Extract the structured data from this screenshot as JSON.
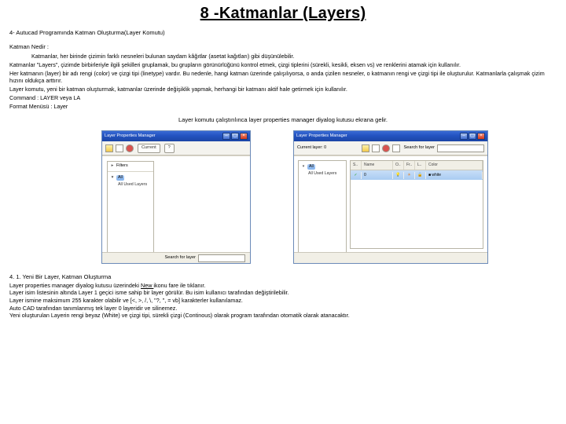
{
  "page": {
    "title": "8 -Katmanlar (Layers)",
    "subheader": "4- Autucad Programında Katman Oluşturma(Layer Komutu)",
    "section_katman_nedir": "Katman Nedir :",
    "p1": "Katmanlar, her birinde çizimin farklı nesneleri bulunan saydam kâğıtlar (asetat kağıtları) gibi düşünülebilir.",
    "p2": "Katmanlar \"Layers\", çizimde birbirleriyle ilgili şekilleri gruplamak, bu grupların görünürlüğünü kontrol etmek, çizgi tiplerini (sürekli, kesikli, eksen vs) ve renklerini atamak için kullanılır.",
    "p3": "Her katmanın (layer) bir adı rengi (color) ve çizgi tipi (linetype) vardır. Bu nedenle, hangi katman üzerinde çalışılıyorsa, o anda çizilen nesneler, o katmanın rengi ve çizgi tipi ile oluşturulur. Katmanlarla çalışmak çizim hızını oldukça arttırır.",
    "p4": "Layer komutu, yeni bir katman oluşturmak, katmanlar üzerinde değişiklik yapmak, herhangi bir katmanı aktif hale getirmek için kullanılır.",
    "p5": "Command : LAYER veya LA",
    "p6": "Format Menüsü : Layer",
    "center": "Layer komutu çalıştırılınca layer properties manager diyalog kutusu ekrana gelir."
  },
  "windows": {
    "dlg1": {
      "title": "Layer Properties Manager",
      "btn_new": "New",
      "btn_current": "Current",
      "btn_help": "?",
      "filter_head": "Filters",
      "filter_all": "All",
      "filter_used": "All Used Layers",
      "search_label": "Search for layer"
    },
    "dlg2": {
      "title": "Layer Properties Manager",
      "btn_current": "Current layer: 0",
      "tree_all": "All",
      "tree_used": "All Used Layers",
      "cols": {
        "s": "S..",
        "name": "Name",
        "on": "O..",
        "fr": "Fr..",
        "lo": "L..",
        "color": "Color"
      },
      "row": {
        "status": "✓",
        "name": "0",
        "on": "💡",
        "freeze": "☀",
        "lock": "🔓",
        "color": "■ white"
      },
      "search_label": "Search for layer"
    }
  },
  "section41": {
    "heading": "4. 1. Yeni Bir Layer, Katman Oluşturma",
    "p1a": "Layer properties manager diyalog kutusu üzerindeki ",
    "p1b": "New ",
    "p1c": "ikonu fare ile tıklanır.",
    "p2": "Layer isim listesinin altında Layer 1 geçici isme sahip bir layer görülür. Bu isim kullanıcı tarafından değiştirilebilir.",
    "p3": "Layer ismine maksimum 255 karakter olabilir ve [<, >, /, \\, \"?, \", = vb] karakterler kullanılamaz.",
    "p4": "Auto CAD tarafından tanımlanmış tek layer 0 layeridir ve silinemez.",
    "p5": "Yeni oluşturulan Layerin rengi beyaz (White) ve çizgi tipi, sürekli çizgi (Continous) olarak program tarafından otomatik olarak atanacaktır."
  }
}
